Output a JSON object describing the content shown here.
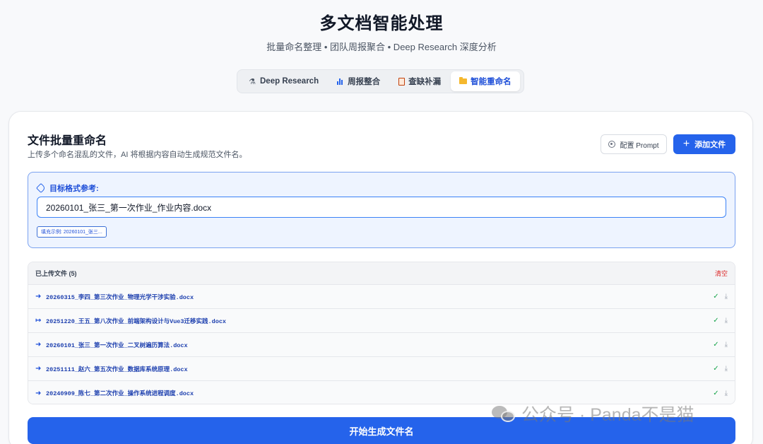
{
  "header": {
    "title": "多文档智能处理",
    "subtitle": "批量命名整理 • 团队周报聚合 • Deep Research 深度分析"
  },
  "tabs": [
    {
      "label": "Deep Research",
      "icon": "flask-icon",
      "active": false
    },
    {
      "label": "周报整合",
      "icon": "bar-chart-icon",
      "active": false
    },
    {
      "label": "查缺补漏",
      "icon": "clipboard-icon",
      "active": false
    },
    {
      "label": "智能重命名",
      "icon": "folder-icon",
      "active": true
    }
  ],
  "card": {
    "title": "文件批量重命名",
    "description": "上传多个命名混乱的文件，AI 将根据内容自动生成规范文件名。",
    "prompt_button": "配置 Prompt",
    "add_button": "添加文件"
  },
  "format": {
    "label": "目标格式参考:",
    "value": "20260101_张三_第一次作业_作业内容.docx",
    "fill_example": "填充示例: 20260101_张三..."
  },
  "files": {
    "title": "已上传文件 (5)",
    "clear_label": "清空",
    "items": [
      {
        "arrow": "➜",
        "name": "20260315_李四_第三次作业_物理光学干涉实验.docx",
        "check": "✓",
        "download": "⤓"
      },
      {
        "arrow": "↦",
        "name": "20251220_王五_第八次作业_前端架构设计与Vue3迁移实践.docx",
        "check": "✓",
        "download": "⤓"
      },
      {
        "arrow": "➜",
        "name": "20260101_张三_第一次作业_二叉树遍历算法.docx",
        "check": "✓",
        "download": "⤓"
      },
      {
        "arrow": "➜",
        "name": "20251111_赵六_第五次作业_数据库系统原理.docx",
        "check": "✓",
        "download": "⤓"
      },
      {
        "arrow": "➜",
        "name": "20240909_陈七_第二次作业_操作系统进程调度.docx",
        "check": "✓",
        "download": "⤓"
      }
    ]
  },
  "generate_button": "开始生成文件名",
  "watermark": "公众号 · Panda不是猫",
  "colors": {
    "accent": "#2563eb",
    "success": "#16a34a",
    "danger": "#dc2626"
  }
}
